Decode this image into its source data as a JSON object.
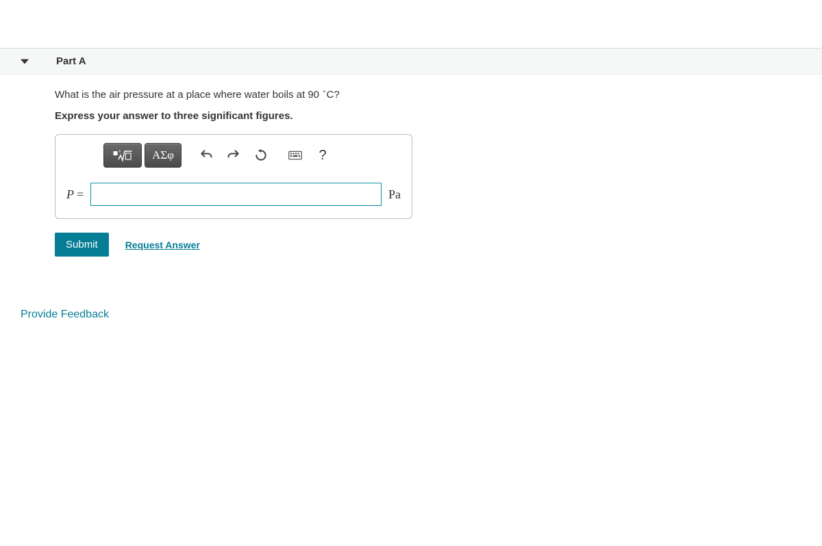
{
  "part": {
    "title": "Part A"
  },
  "question": {
    "text_prefix": "What is the air pressure at a place where water boils at 90 ",
    "degree": "∘",
    "unit_temp": "C",
    "text_suffix": "?",
    "instruction": "Express your answer to three significant figures."
  },
  "input": {
    "variable": "P",
    "equals": "=",
    "value": "",
    "unit": "Pa"
  },
  "toolbar": {
    "templates_label": "templates",
    "symbols_label": "ΑΣφ",
    "undo": "undo",
    "redo": "redo",
    "reset": "reset",
    "keyboard": "keyboard",
    "help": "?"
  },
  "actions": {
    "submit": "Submit",
    "request": "Request Answer"
  },
  "feedback": {
    "label": "Provide Feedback"
  }
}
